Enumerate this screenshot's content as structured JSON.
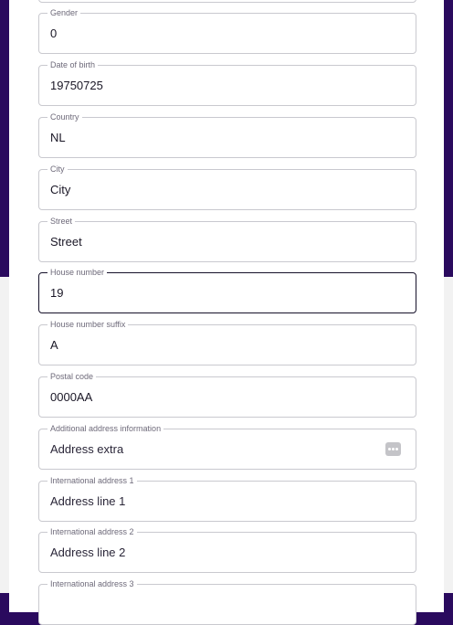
{
  "form": {
    "fields": [
      {
        "label": "Gender",
        "value": "0"
      },
      {
        "label": "Date of birth",
        "value": "19750725"
      },
      {
        "label": "Country",
        "value": "NL"
      },
      {
        "label": "City",
        "value": "City"
      },
      {
        "label": "Street",
        "value": "Street"
      },
      {
        "label": "House number",
        "value": "19"
      },
      {
        "label": "House number suffix",
        "value": "A"
      },
      {
        "label": "Postal code",
        "value": "0000AA"
      },
      {
        "label": "Additional address information",
        "value": "Address extra"
      },
      {
        "label": "International address 1",
        "value": "Address line 1"
      },
      {
        "label": "International address 2",
        "value": "Address line 2"
      },
      {
        "label": "International address 3",
        "value": ""
      }
    ],
    "aux_icon": "password-manager-icon"
  },
  "colors": {
    "header_bg": "#2a0a5e",
    "page_bg": "#f2f2f2",
    "border": "#c9c9cf",
    "focus_border": "#16112a"
  }
}
